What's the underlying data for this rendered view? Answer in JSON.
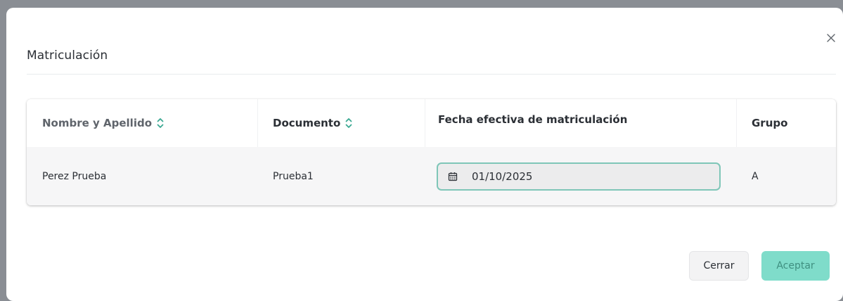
{
  "modal": {
    "title": "Matriculación",
    "close_icon": "close-icon"
  },
  "table": {
    "headers": {
      "name": "Nombre y Apellido",
      "document": "Documento",
      "date": "Fecha efectiva de matriculación",
      "group": "Grupo"
    },
    "sortable": [
      "name",
      "document"
    ],
    "rows": [
      {
        "name": "Perez Prueba",
        "document": "Prueba1",
        "date": "01/10/2025",
        "group": "A"
      }
    ]
  },
  "footer": {
    "close_label": "Cerrar",
    "accept_label": "Aceptar"
  },
  "colors": {
    "accent": "#3ba892",
    "accept_bg": "#7fdcca",
    "input_border": "#7fc6b8"
  }
}
